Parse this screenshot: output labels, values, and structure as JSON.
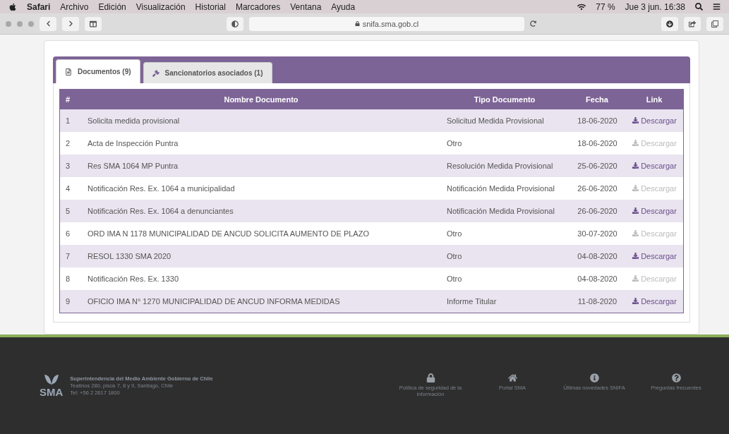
{
  "menu_bar": {
    "app": "Safari",
    "items": [
      "Archivo",
      "Edición",
      "Visualización",
      "Historial",
      "Marcadores",
      "Ventana",
      "Ayuda"
    ],
    "battery": "77 %",
    "clock": "Jue 3 jun. 16:38"
  },
  "browser": {
    "address": "snifa.sma.gob.cl"
  },
  "tabs": [
    {
      "label": "Documentos (9)",
      "selected": true,
      "kind": "document"
    },
    {
      "label": "Sancionatorios asociados (1)",
      "selected": false,
      "kind": "gavel"
    }
  ],
  "table": {
    "columns": [
      "#",
      "Nombre Documento",
      "Tipo Documento",
      "Fecha",
      "Link"
    ],
    "rows": [
      {
        "number": "1",
        "name": "Solicita medida provisional",
        "type": "Solicitud Medida Provisional",
        "date": "18-06-2020",
        "link": "Descargar",
        "disabled": false
      },
      {
        "number": "2",
        "name": "Acta de Inspección Puntra",
        "type": "Otro",
        "date": "18-06-2020",
        "link": "Descargar",
        "disabled": true
      },
      {
        "number": "3",
        "name": "Res SMA 1064 MP Puntra",
        "type": "Resolución Medida Provisional",
        "date": "25-06-2020",
        "link": "Descargar",
        "disabled": false
      },
      {
        "number": "4",
        "name": "Notificación Res. Ex. 1064 a municipalidad",
        "type": "Notificación Medida Provisional",
        "date": "26-06-2020",
        "link": "Descargar",
        "disabled": true
      },
      {
        "number": "5",
        "name": "Notificación Res. Ex. 1064 a denunciantes",
        "type": "Notificación Medida Provisional",
        "date": "26-06-2020",
        "link": "Descargar",
        "disabled": false
      },
      {
        "number": "6",
        "name": "ORD IMA N 1178 MUNICIPALIDAD DE ANCUD SOLICITA AUMENTO DE PLAZO",
        "type": "Otro",
        "date": "30-07-2020",
        "link": "Descargar",
        "disabled": true
      },
      {
        "number": "7",
        "name": "RESOL 1330 SMA 2020",
        "type": "Otro",
        "date": "04-08-2020",
        "link": "Descargar",
        "disabled": false
      },
      {
        "number": "8",
        "name": "Notificación Res. Ex. 1330",
        "type": "Otro",
        "date": "04-08-2020",
        "link": "Descargar",
        "disabled": true
      },
      {
        "number": "9",
        "name": "OFICIO IMA N° 1270 MUNICIPALIDAD DE ANCUD INFORMA MEDIDAS",
        "type": "Informe Titular",
        "date": "11-08-2020",
        "link": "Descargar",
        "disabled": false
      }
    ]
  },
  "footer": {
    "logo": "SMA",
    "org": "Superintendencia del Medio Ambiente Gobierno de Chile",
    "address": "Teatinos 280, pisos 7, 8 y 9, Santiago, Chile",
    "phone": "Tel: +56 2 2617 1800",
    "links": [
      {
        "label": "Política de seguridad de la información",
        "kind": "lock"
      },
      {
        "label": "Portal SMA",
        "kind": "home"
      },
      {
        "label": "Últimas novedades SNIFA",
        "kind": "info"
      },
      {
        "label": "Preguntas frecuentes",
        "kind": "question"
      }
    ]
  }
}
